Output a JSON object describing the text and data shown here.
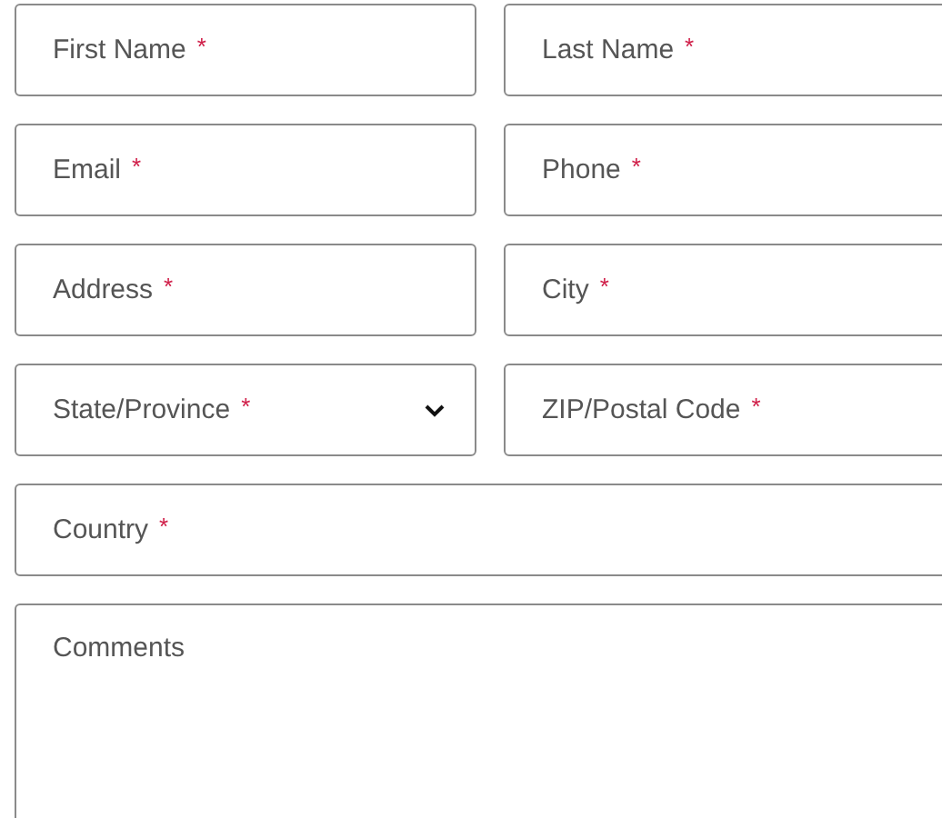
{
  "required_mark": "*",
  "fields": [
    {
      "kind": "text",
      "placeholder": "First Name",
      "required": true,
      "wide": false
    },
    {
      "kind": "text",
      "placeholder": "Last Name",
      "required": true,
      "wide": false
    },
    {
      "kind": "text",
      "placeholder": "Email",
      "required": true,
      "wide": false
    },
    {
      "kind": "text",
      "placeholder": "Phone",
      "required": true,
      "wide": false
    },
    {
      "kind": "text",
      "placeholder": "Address",
      "required": true,
      "wide": false
    },
    {
      "kind": "text",
      "placeholder": "City",
      "required": true,
      "wide": false
    },
    {
      "kind": "select",
      "placeholder": "State/Province",
      "required": true,
      "wide": false
    },
    {
      "kind": "text",
      "placeholder": "ZIP/Postal Code",
      "required": true,
      "wide": false
    },
    {
      "kind": "text",
      "placeholder": "Country",
      "required": true,
      "wide": true
    },
    {
      "kind": "textarea",
      "placeholder": "Comments",
      "required": false,
      "wide": true
    }
  ]
}
